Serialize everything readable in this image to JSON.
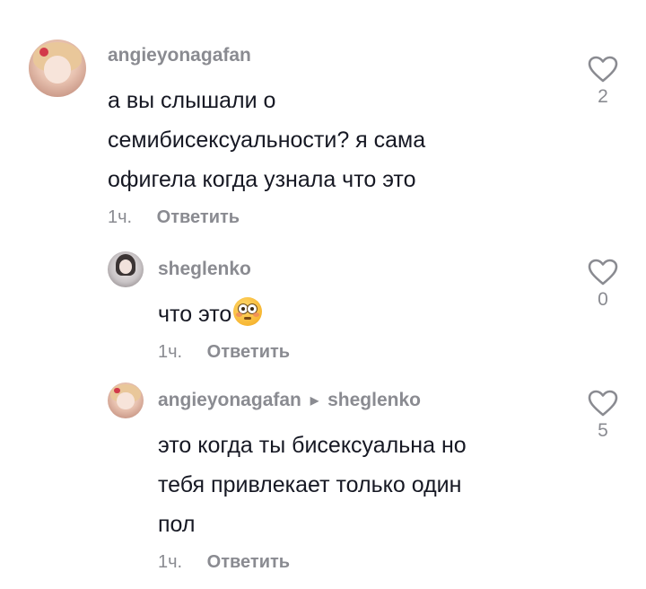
{
  "comments": [
    {
      "username": "angieyonagafan",
      "lines": [
        "а вы слышали о",
        "семибисексуальности? я сама",
        "офигела когда узнала что это"
      ],
      "time": "1ч.",
      "reply_label": "Ответить",
      "likes": "2",
      "avatar_icon": "anime-avatar-icon"
    },
    {
      "username": "sheglenko",
      "text": "что это",
      "emoji": "flushed-face-emoji",
      "time": "1ч.",
      "reply_label": "Ответить",
      "likes": "0",
      "avatar_icon": "photo-avatar-icon"
    },
    {
      "username": "angieyonagafan",
      "reply_to": "sheglenko",
      "lines": [
        "это когда ты бисексуальна но",
        "тебя привлекает только один",
        "пол"
      ],
      "time": "1ч.",
      "reply_label": "Ответить",
      "likes": "5",
      "avatar_icon": "anime-avatar-icon"
    }
  ],
  "colors": {
    "text": "#161823",
    "muted": "#8a8b91",
    "background": "#ffffff"
  }
}
